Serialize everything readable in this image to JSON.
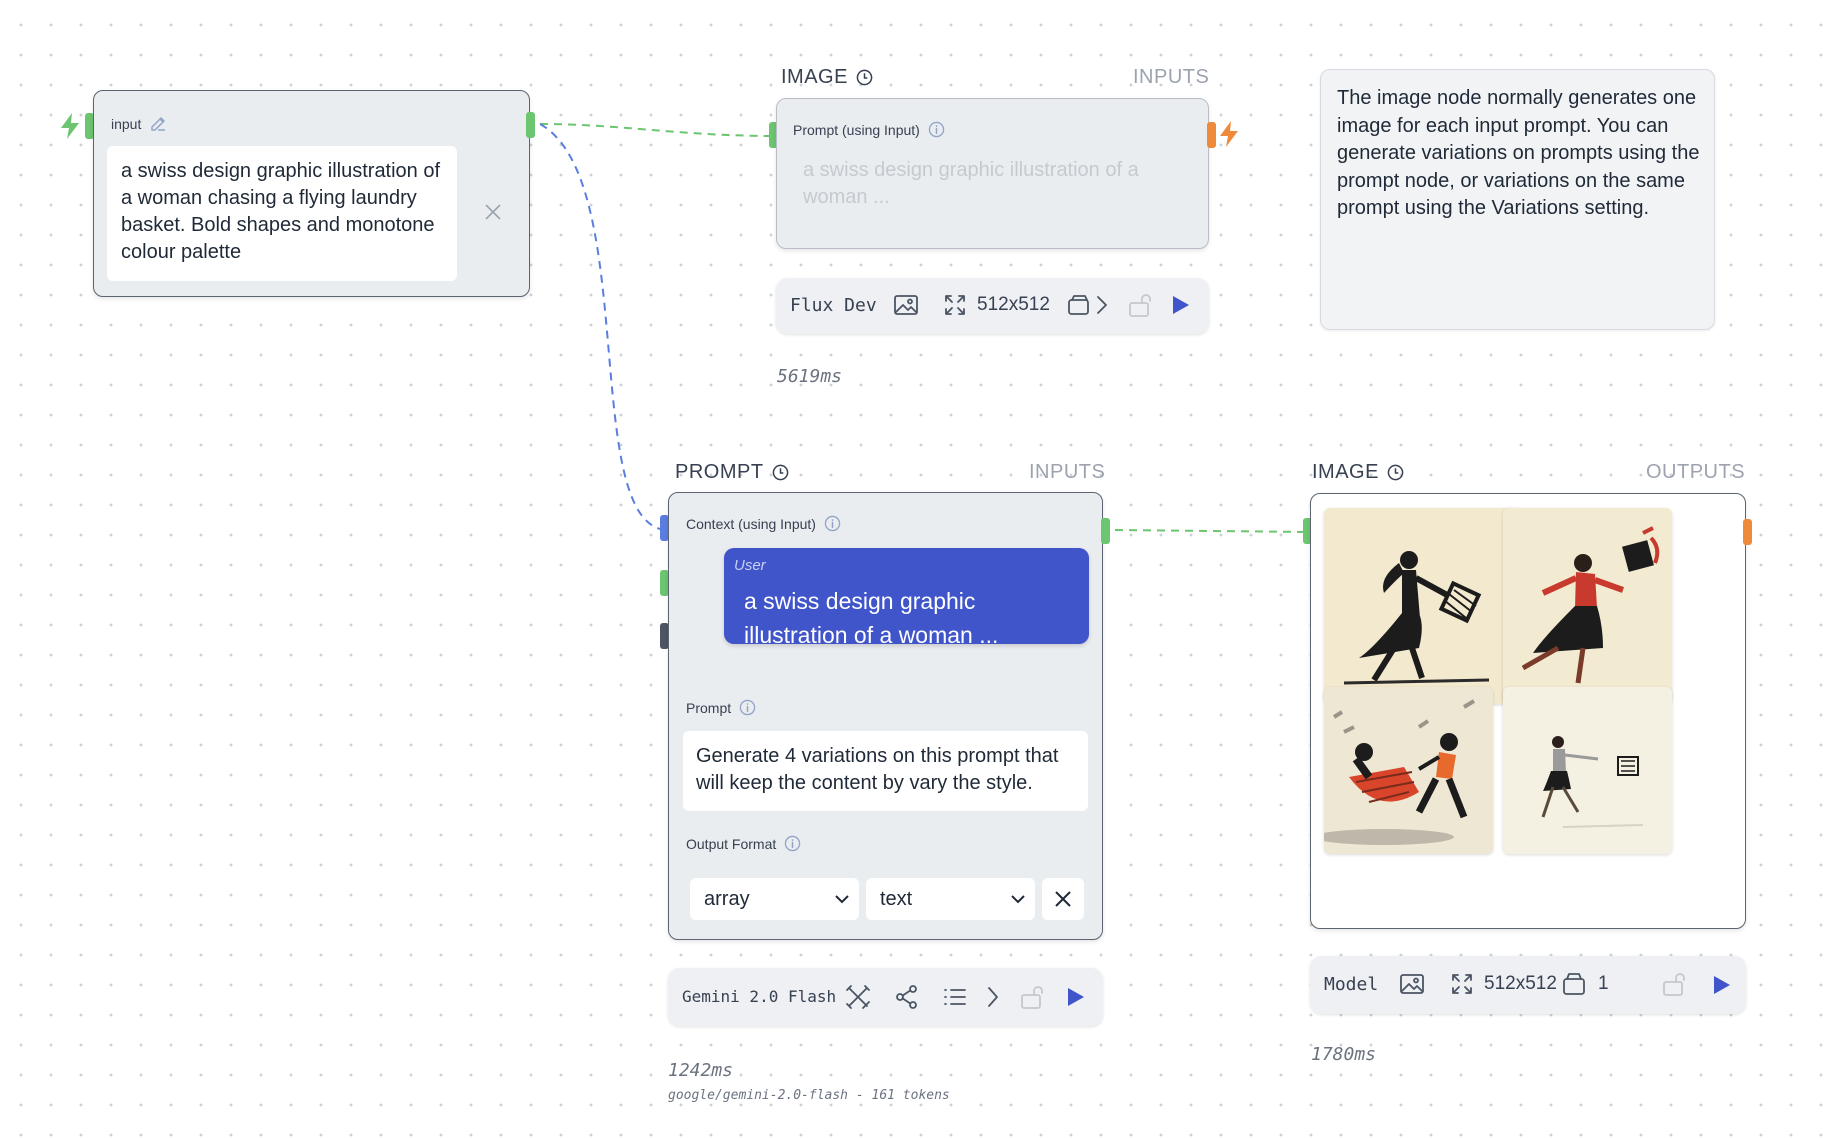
{
  "input_node": {
    "label": "input",
    "text": "a swiss design graphic illustration of a woman chasing a flying laundry basket. Bold shapes and monotone colour palette"
  },
  "image_node_top": {
    "title": "IMAGE",
    "tag": "INPUTS",
    "prompt_label": "Prompt (using Input)",
    "prompt_placeholder": "a swiss design graphic illustration of a woman ...",
    "toolbar": {
      "model": "Flux Dev",
      "size": "512x512"
    },
    "timing": "5619ms"
  },
  "note": {
    "text": "The image node normally generates one image for each input prompt. You can generate variations on prompts using the prompt node, or variations on the same prompt using the Variations setting."
  },
  "prompt_node": {
    "title": "PROMPT",
    "tag": "INPUTS",
    "context_label": "Context (using Input)",
    "bubble_role": "User",
    "bubble_text": "a swiss design graphic illustration of a woman ...",
    "prompt_label": "Prompt",
    "prompt_text": "Generate 4 variations on this prompt that will keep the content by vary the style.",
    "output_format_label": "Output Format",
    "format_select": "array",
    "type_select": "text",
    "toolbar": {
      "model": "Gemini 2.0 Flash"
    },
    "timing": "1242ms",
    "meta": "google/gemini-2.0-flash - 161 tokens"
  },
  "image_node_bottom": {
    "title": "IMAGE",
    "tag": "OUTPUTS",
    "toolbar": {
      "model": "Model",
      "size": "512x512",
      "count": "1"
    },
    "timing": "1780ms"
  },
  "colors": {
    "accent_blue": "#3f55c9",
    "edge_green": "#6cc56f",
    "edge_blue": "#5a7ee0",
    "handle_orange": "#f08a3b"
  }
}
